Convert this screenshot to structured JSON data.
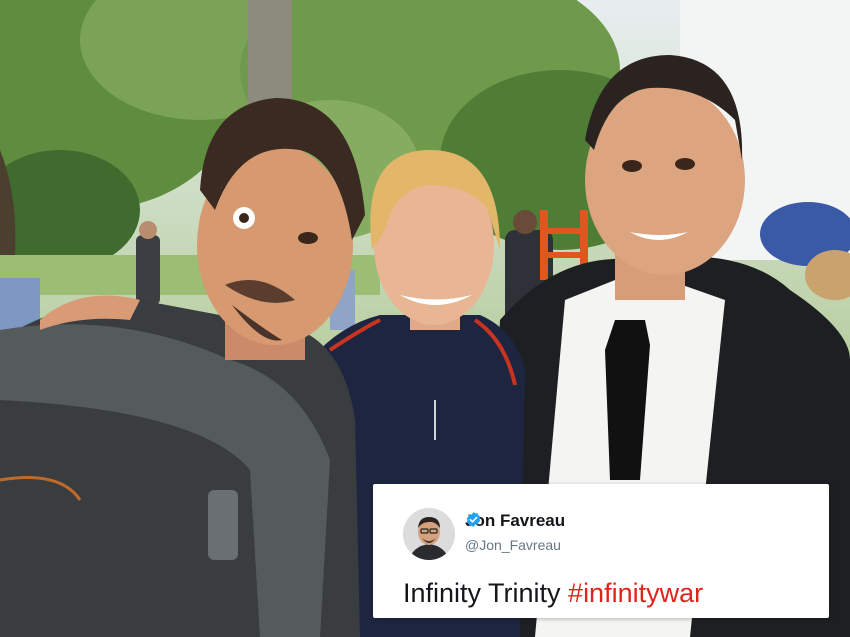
{
  "photo": {
    "description_icon": "group-selfie-photo",
    "colors": {
      "sky": "#e9eef0",
      "foliage": "#6f9a4c",
      "foliage_dark": "#3f6b2e",
      "grass": "#8db26a",
      "suit": "#1d1f22",
      "navy_jacket": "#1e2540",
      "jacket_stripe": "#c8341f",
      "shirt": "#f4f4f2",
      "skin": "#e2aa84",
      "blonde_hair": "#e2b76a",
      "dark_hair": "#3a2a22",
      "scarf": "#555b5d"
    }
  },
  "tweet": {
    "display_name": "Jon Favreau",
    "handle": "@Jon_Favreau",
    "text_plain": "Infinity Trinity ",
    "hashtag": "#infinitywar",
    "verified": true,
    "verified_icon": "verified-badge-icon",
    "avatar_icon": "profile-avatar",
    "colors": {
      "card_bg": "#ffffff",
      "name": "#14171a",
      "handle": "#657786",
      "hashtag": "#e0241b",
      "verified": "#1da1f2"
    }
  }
}
